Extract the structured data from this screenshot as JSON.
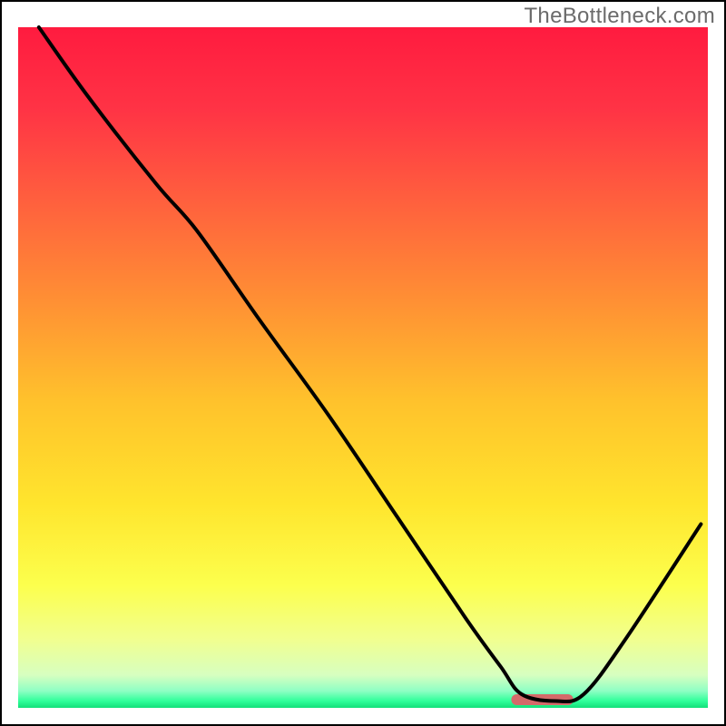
{
  "watermark": "TheBottleneck.com",
  "chart_data": {
    "type": "line",
    "title": "",
    "xlabel": "",
    "ylabel": "",
    "xlim": [
      0,
      100
    ],
    "ylim": [
      0,
      100
    ],
    "grid": false,
    "legend": false,
    "background_gradient": {
      "type": "vertical",
      "stops": [
        {
          "offset": 0.0,
          "color": "#ff1b3f"
        },
        {
          "offset": 0.12,
          "color": "#ff3345"
        },
        {
          "offset": 0.25,
          "color": "#ff5e3e"
        },
        {
          "offset": 0.4,
          "color": "#ff8f34"
        },
        {
          "offset": 0.55,
          "color": "#ffc22c"
        },
        {
          "offset": 0.7,
          "color": "#ffe52d"
        },
        {
          "offset": 0.82,
          "color": "#fcff4d"
        },
        {
          "offset": 0.9,
          "color": "#f1ff90"
        },
        {
          "offset": 0.952,
          "color": "#d7ffc0"
        },
        {
          "offset": 0.975,
          "color": "#8fffc4"
        },
        {
          "offset": 0.99,
          "color": "#2fff9a"
        },
        {
          "offset": 1.0,
          "color": "#13e07a"
        }
      ]
    },
    "series": [
      {
        "name": "bottleneck-curve",
        "color": "#000000",
        "x": [
          3,
          10,
          20,
          26,
          35,
          45,
          55,
          65,
          70,
          73,
          78,
          82,
          88,
          99
        ],
        "y": [
          100,
          90,
          77,
          70,
          57,
          43,
          28,
          13,
          6,
          2,
          1,
          2,
          10,
          27
        ]
      }
    ],
    "marker": {
      "name": "optimal-range-marker",
      "x_center": 76,
      "x_width": 9,
      "y": 1.2,
      "color": "#d46a6a"
    }
  }
}
